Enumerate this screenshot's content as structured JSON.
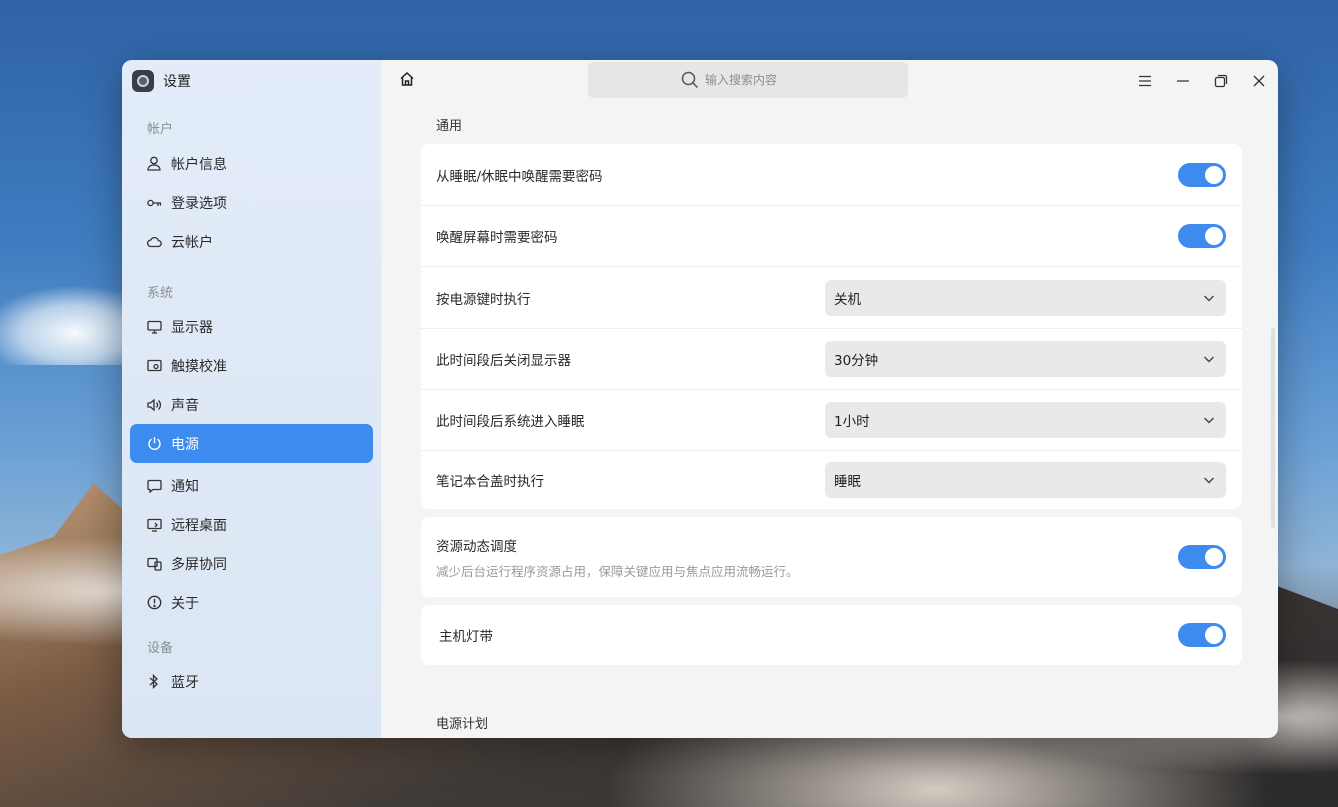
{
  "app": {
    "title": "设置"
  },
  "sidebar": {
    "groups": [
      {
        "title": "帐户",
        "items": [
          {
            "label": "帐户信息",
            "icon": "user-icon"
          },
          {
            "label": "登录选项",
            "icon": "key-icon"
          },
          {
            "label": "云帐户",
            "icon": "cloud-icon"
          }
        ]
      },
      {
        "title": "系统",
        "items": [
          {
            "label": "显示器",
            "icon": "monitor-icon"
          },
          {
            "label": "触摸校准",
            "icon": "touch-icon"
          },
          {
            "label": "声音",
            "icon": "speaker-icon"
          },
          {
            "label": "电源",
            "icon": "power-icon",
            "active": true
          },
          {
            "label": "通知",
            "icon": "notification-icon"
          },
          {
            "label": "远程桌面",
            "icon": "remote-desktop-icon"
          },
          {
            "label": "多屏协同",
            "icon": "multiscreen-icon"
          },
          {
            "label": "关于",
            "icon": "info-icon"
          }
        ]
      },
      {
        "title": "设备",
        "items": [
          {
            "label": "蓝牙",
            "icon": "bluetooth-icon"
          }
        ]
      }
    ]
  },
  "search": {
    "placeholder": "输入搜索内容"
  },
  "content": {
    "general_title": "通用",
    "rows": [
      {
        "label": "从睡眠/休眠中唤醒需要密码",
        "toggle": true
      },
      {
        "label": "唤醒屏幕时需要密码",
        "toggle": true
      },
      {
        "label": "按电源键时执行",
        "value": "关机"
      },
      {
        "label": "此时间段后关闭显示器",
        "value": "30分钟"
      },
      {
        "label": "此时间段后系统进入睡眠",
        "value": "1小时"
      },
      {
        "label": "笔记本合盖时执行",
        "value": "睡眠"
      }
    ],
    "resource": {
      "label": "资源动态调度",
      "desc": "减少后台运行程序资源占用，保障关键应用与焦点应用流畅运行。",
      "toggle": true
    },
    "lightstrip": {
      "label": "主机灯带",
      "toggle": true
    },
    "power_plan_title": "电源计划"
  },
  "colors": {
    "accent": "#3e8bf0"
  }
}
